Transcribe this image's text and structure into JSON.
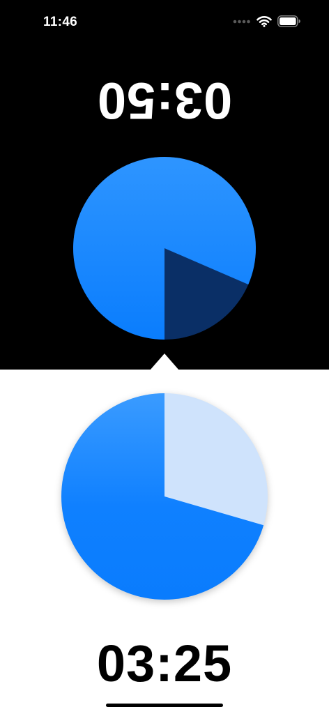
{
  "status_bar": {
    "time": "11:46",
    "icons": [
      "signal-dots-icon",
      "wifi-icon",
      "battery-icon"
    ]
  },
  "opponent": {
    "timer": "03:50",
    "orientation": "upside-down",
    "remaining_fraction": 0.815,
    "colors": {
      "background": "#000000",
      "remaining": "#1e8cff",
      "elapsed": "#0a2f66",
      "text": "#ffffff"
    }
  },
  "player": {
    "timer": "03:25",
    "remaining_fraction": 0.705,
    "active": true,
    "colors": {
      "background": "#ffffff",
      "remaining": "#1a84ff",
      "elapsed": "#cfe3fc",
      "text": "#000000"
    }
  }
}
